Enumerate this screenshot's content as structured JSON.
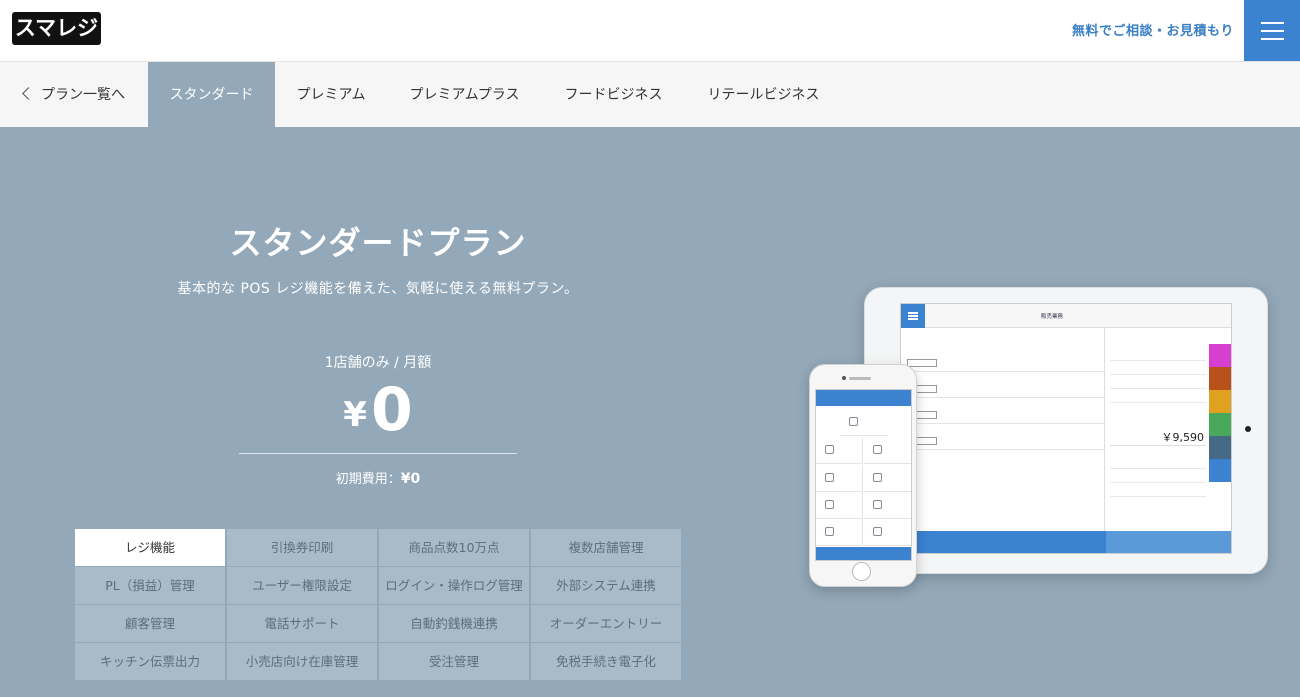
{
  "header": {
    "logo": "スマレジ",
    "consult_link": "無料でご相談・お見積もり"
  },
  "tabs": {
    "back_label": "プラン一覧へ",
    "items": [
      "スタンダード",
      "プレミアム",
      "プレミアムプラス",
      "フードビジネス",
      "リテールビジネス"
    ],
    "active_index": 0
  },
  "hero": {
    "title": "スタンダードプラン",
    "subtitle": "基本的な POS レジ機能を備えた、気軽に使える無料プラン。",
    "price_label": "1店舗のみ / 月額",
    "price_currency": "¥",
    "price_value": "0",
    "initial_fee_label": "初期費用：",
    "initial_fee_value": "¥0"
  },
  "features": [
    "レジ機能",
    "引換券印刷",
    "商品点数10万点",
    "複数店舗管理",
    "PL（損益）管理",
    "ユーザー権限設定",
    "ログイン・操作ログ管理",
    "外部システム連携",
    "顧客管理",
    "電話サポート",
    "自動釣銭機連携",
    "オーダーエントリー",
    "キッチン伝票出力",
    "小売店向け在庫管理",
    "受注管理",
    "免税手続き電子化"
  ],
  "device": {
    "ipad_title": "販売業務",
    "ipad_total": "￥9,590",
    "ipad_accent_colors": [
      "#d63fd0",
      "#b8521c",
      "#e0a020",
      "#4aa85a",
      "#466a86",
      "#3b82d0",
      "#ffffff",
      "#ffffff"
    ]
  },
  "colors": {
    "accent": "#3b82d0",
    "hero_bg": "#93a8b8",
    "feature_cell": "#a9bbc8"
  }
}
